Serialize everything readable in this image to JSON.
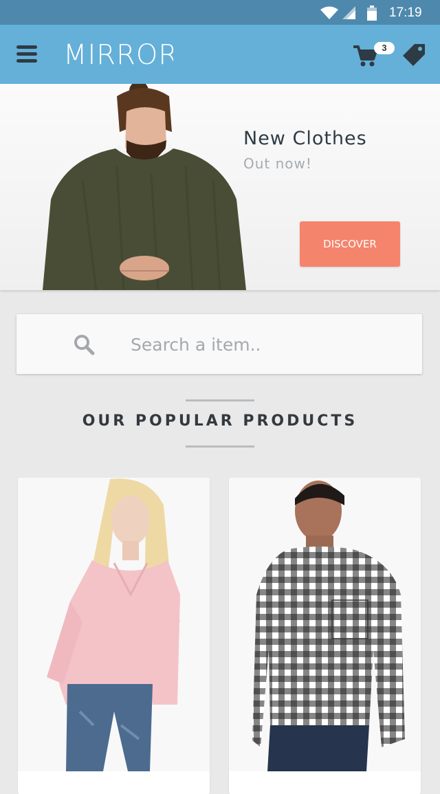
{
  "status_bar": {
    "time": "17:19"
  },
  "app_bar": {
    "logo_text": "MIRROR",
    "cart_count": "3"
  },
  "hero": {
    "title": "New Clothes",
    "subtitle": "Out now!",
    "button_label": "DISCOVER"
  },
  "search": {
    "placeholder": "Search a item.."
  },
  "section": {
    "title": "OUR POPULAR PRODUCTS"
  },
  "colors": {
    "status_bar": "#4f88ad",
    "app_bar": "#64b0d8",
    "accent": "#f5846c",
    "background": "#e9e9e9"
  },
  "icons": [
    "menu-icon",
    "cart-icon",
    "tag-icon",
    "search-icon",
    "wifi-icon",
    "signal-icon",
    "battery-icon"
  ]
}
